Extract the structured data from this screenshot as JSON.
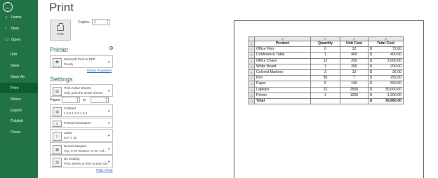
{
  "nav": {
    "back_icon": "←",
    "items": [
      {
        "icon": "⌂",
        "label": "Home"
      },
      {
        "icon": "▫",
        "label": "New"
      },
      {
        "icon": "▭",
        "label": "Open"
      },
      {
        "icon": "",
        "label": "Info"
      },
      {
        "icon": "",
        "label": "Save"
      },
      {
        "icon": "",
        "label": "Save As"
      },
      {
        "icon": "",
        "label": "Print"
      },
      {
        "icon": "",
        "label": "Share"
      },
      {
        "icon": "",
        "label": "Export"
      },
      {
        "icon": "",
        "label": "Publish"
      },
      {
        "icon": "",
        "label": "Close"
      }
    ],
    "selected": "Print",
    "bg_color": "#217346"
  },
  "print": {
    "title": "Print",
    "button_label": "Print",
    "copies_label": "Copies:",
    "copies_value": "1"
  },
  "printer": {
    "heading": "Printer",
    "name": "Microsoft Print to PDF",
    "status": "Ready",
    "properties_link": "Printer Properties",
    "info_icon": "i"
  },
  "settings": {
    "heading": "Settings",
    "what": {
      "line1": "Print Active Sheets",
      "line2": "Only print the active sheets"
    },
    "pages_label": "Pages:",
    "to_label": "to",
    "collate": {
      "line1": "Collated",
      "line2": "1,2,3    1,2,3    1,2,3"
    },
    "orientation": {
      "line1": "Portrait Orientation"
    },
    "paper": {
      "line1": "Letter",
      "line2": "8.5\" x 11\""
    },
    "margins": {
      "line1": "Normal Margins",
      "line2": "Top: 0.75\" Bottom: 0.75\" Lef..."
    },
    "scaling": {
      "line1": "No Scaling",
      "line2": "Print sheets at their actual size"
    },
    "page_setup_link": "Page Setup"
  },
  "sheet": {
    "col_letters": [
      "A",
      "B",
      "C",
      "D"
    ],
    "headers": [
      "Product",
      "Quantity",
      "Unit Cost",
      "Total Cost"
    ],
    "rows": [
      {
        "n": "2",
        "product": "Office Files",
        "qty": "6",
        "unit": "12",
        "total": "72.00"
      },
      {
        "n": "3",
        "product": "Conference Table",
        "qty": "1",
        "unit": "400",
        "total": "400.00"
      },
      {
        "n": "4",
        "product": "Office Chairs",
        "qty": "12",
        "unit": "250",
        "total": "3,000.00"
      },
      {
        "n": "5",
        "product": "White Board",
        "qty": "1",
        "unit": "200",
        "total": "200.00"
      },
      {
        "n": "6",
        "product": "Colored Markers",
        "qty": "3",
        "unit": "12",
        "total": "36.00"
      },
      {
        "n": "7",
        "product": "Pen",
        "qty": "36",
        "unit": "7",
        "total": "252.00"
      },
      {
        "n": "8",
        "product": "Paper",
        "qty": "5",
        "unit": "100",
        "total": "500.00"
      },
      {
        "n": "9",
        "product": "Laptops",
        "qty": "12",
        "unit": "2500",
        "total": "30,000.00"
      },
      {
        "n": "10",
        "product": "Printer",
        "qty": "1",
        "unit": "1200",
        "total": "1,200.00"
      }
    ],
    "total_label": "Total",
    "total_value": "35,660.00",
    "currency": "$"
  }
}
